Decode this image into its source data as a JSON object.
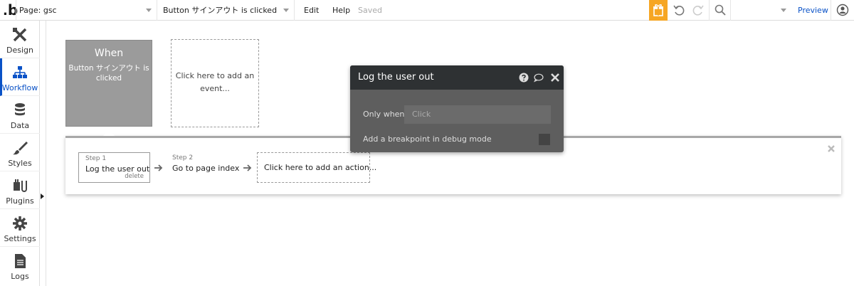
{
  "topbar": {
    "page_select": "Page: gsc",
    "event_select": "Button サインアウト is clicked",
    "menu_edit": "Edit",
    "menu_help": "Help",
    "status": "Saved",
    "preview_label": "Preview",
    "accent_color": "#f6a623",
    "link_color": "#0a52c7"
  },
  "sidebar": {
    "items": [
      {
        "label": "Design",
        "icon": "design-icon"
      },
      {
        "label": "Workflow",
        "icon": "workflow-icon",
        "active": true
      },
      {
        "label": "Data",
        "icon": "database-icon"
      },
      {
        "label": "Styles",
        "icon": "brush-icon"
      },
      {
        "label": "Plugins",
        "icon": "plug-icon"
      },
      {
        "label": "Settings",
        "icon": "gear-icon"
      },
      {
        "label": "Logs",
        "icon": "document-icon"
      }
    ]
  },
  "canvas": {
    "event": {
      "title": "When",
      "subtitle": "Button サインアウト is clicked"
    },
    "add_event": "Click here to add an event...",
    "steps": [
      {
        "label": "Step 1",
        "name": "Log the user out",
        "delete": "delete"
      },
      {
        "label": "Step 2",
        "name": "Go to page index"
      }
    ],
    "add_action": "Click here to add an action..."
  },
  "popup": {
    "title": "Log the user out",
    "only_when_label": "Only when",
    "only_when_placeholder": "Click",
    "breakpoint_label": "Add a breakpoint in debug mode"
  }
}
